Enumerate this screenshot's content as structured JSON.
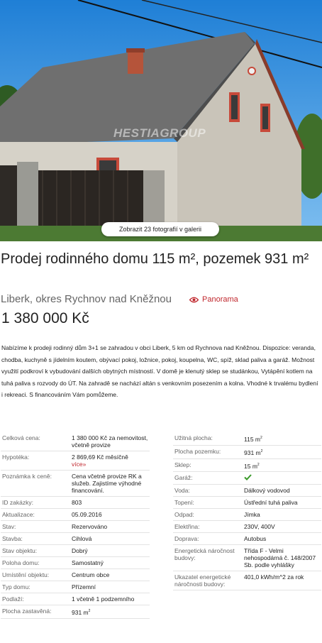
{
  "gallery": {
    "button_label": "Zobrazit 23 fotografií v galerii",
    "watermark": "HESTIAGROUP"
  },
  "listing": {
    "title": "Prodej rodinného domu 115 m², pozemek 931 m²",
    "location": "Liberk, okres Rychnov nad Kněžnou",
    "panorama_label": "Panorama",
    "price": "1 380 000 Kč",
    "description": "Nabízíme k prodeji rodinný dům 3+1 se zahradou v obci Liberk, 5 km od Rychnova nad Kněžnou. Dispozice: veranda, chodba, kuchyně s jídelním koutem, obývací pokoj, ložnice, pokoj, koupelna, WC, spíž, sklad paliva a garáž. Možnost využití podkroví k vybudování dalších obytných místností. V domě je klenutý sklep se studánkou, Vytápění kotlem na tuhá paliva s rozvody do ÚT. Na zahradě se nachází altán s venkovním posezením a kolna. Vhodné k trvalému bydlení i rekreaci. S financováním Vám pomůžeme."
  },
  "params_left": [
    {
      "key": "Celková cena:",
      "value": "1 380 000 Kč za nemovitost, včetně provize"
    },
    {
      "key": "Hypotéka:",
      "value": "2 869,69 Kč měsíčně",
      "link": "více»"
    },
    {
      "key": "Poznámka k ceně:",
      "value": "Cena včetně provize RK a služeb. Zajistíme výhodné financování."
    },
    {
      "key": "ID zakázky:",
      "value": "803"
    },
    {
      "key": "Aktualizace:",
      "value": "05.09.2016"
    },
    {
      "key": "Stav:",
      "value": "Rezervováno"
    },
    {
      "key": "Stavba:",
      "value": "Cihlová"
    },
    {
      "key": "Stav objektu:",
      "value": "Dobrý"
    },
    {
      "key": "Poloha domu:",
      "value": "Samostatný"
    },
    {
      "key": "Umístění objektu:",
      "value": "Centrum obce"
    },
    {
      "key": "Typ domu:",
      "value": "Přízemní"
    },
    {
      "key": "Podlaží:",
      "value": "1 včetně 1 podzemního"
    },
    {
      "key": "Plocha zastavěná:",
      "value": "931 m",
      "sup": "2"
    }
  ],
  "params_right": [
    {
      "key": "Užitná plocha:",
      "value": "115 m",
      "sup": "2"
    },
    {
      "key": "Plocha pozemku:",
      "value": "931 m",
      "sup": "2"
    },
    {
      "key": "Sklep:",
      "value": "15 m",
      "sup": "2"
    },
    {
      "key": "Garáž:",
      "value": "",
      "icon": "check-icon"
    },
    {
      "key": "Voda:",
      "value": "Dálkový vodovod"
    },
    {
      "key": "Topení:",
      "value": "Ústřední tuhá paliva"
    },
    {
      "key": "Odpad:",
      "value": "Jímka"
    },
    {
      "key": "Elektřina:",
      "value": "230V, 400V"
    },
    {
      "key": "Doprava:",
      "value": "Autobus"
    },
    {
      "key": "Energetická náročnost budovy:",
      "value": "Třída F - Velmi nehospodárná č. 148/2007 Sb. podle vyhlášky"
    },
    {
      "key": "Ukazatel energetické náročnosti budovy:",
      "value": "401,0 kWh/m^2 za rok"
    }
  ],
  "colors": {
    "accent": "#c0272d",
    "check": "#3a9a2a"
  }
}
